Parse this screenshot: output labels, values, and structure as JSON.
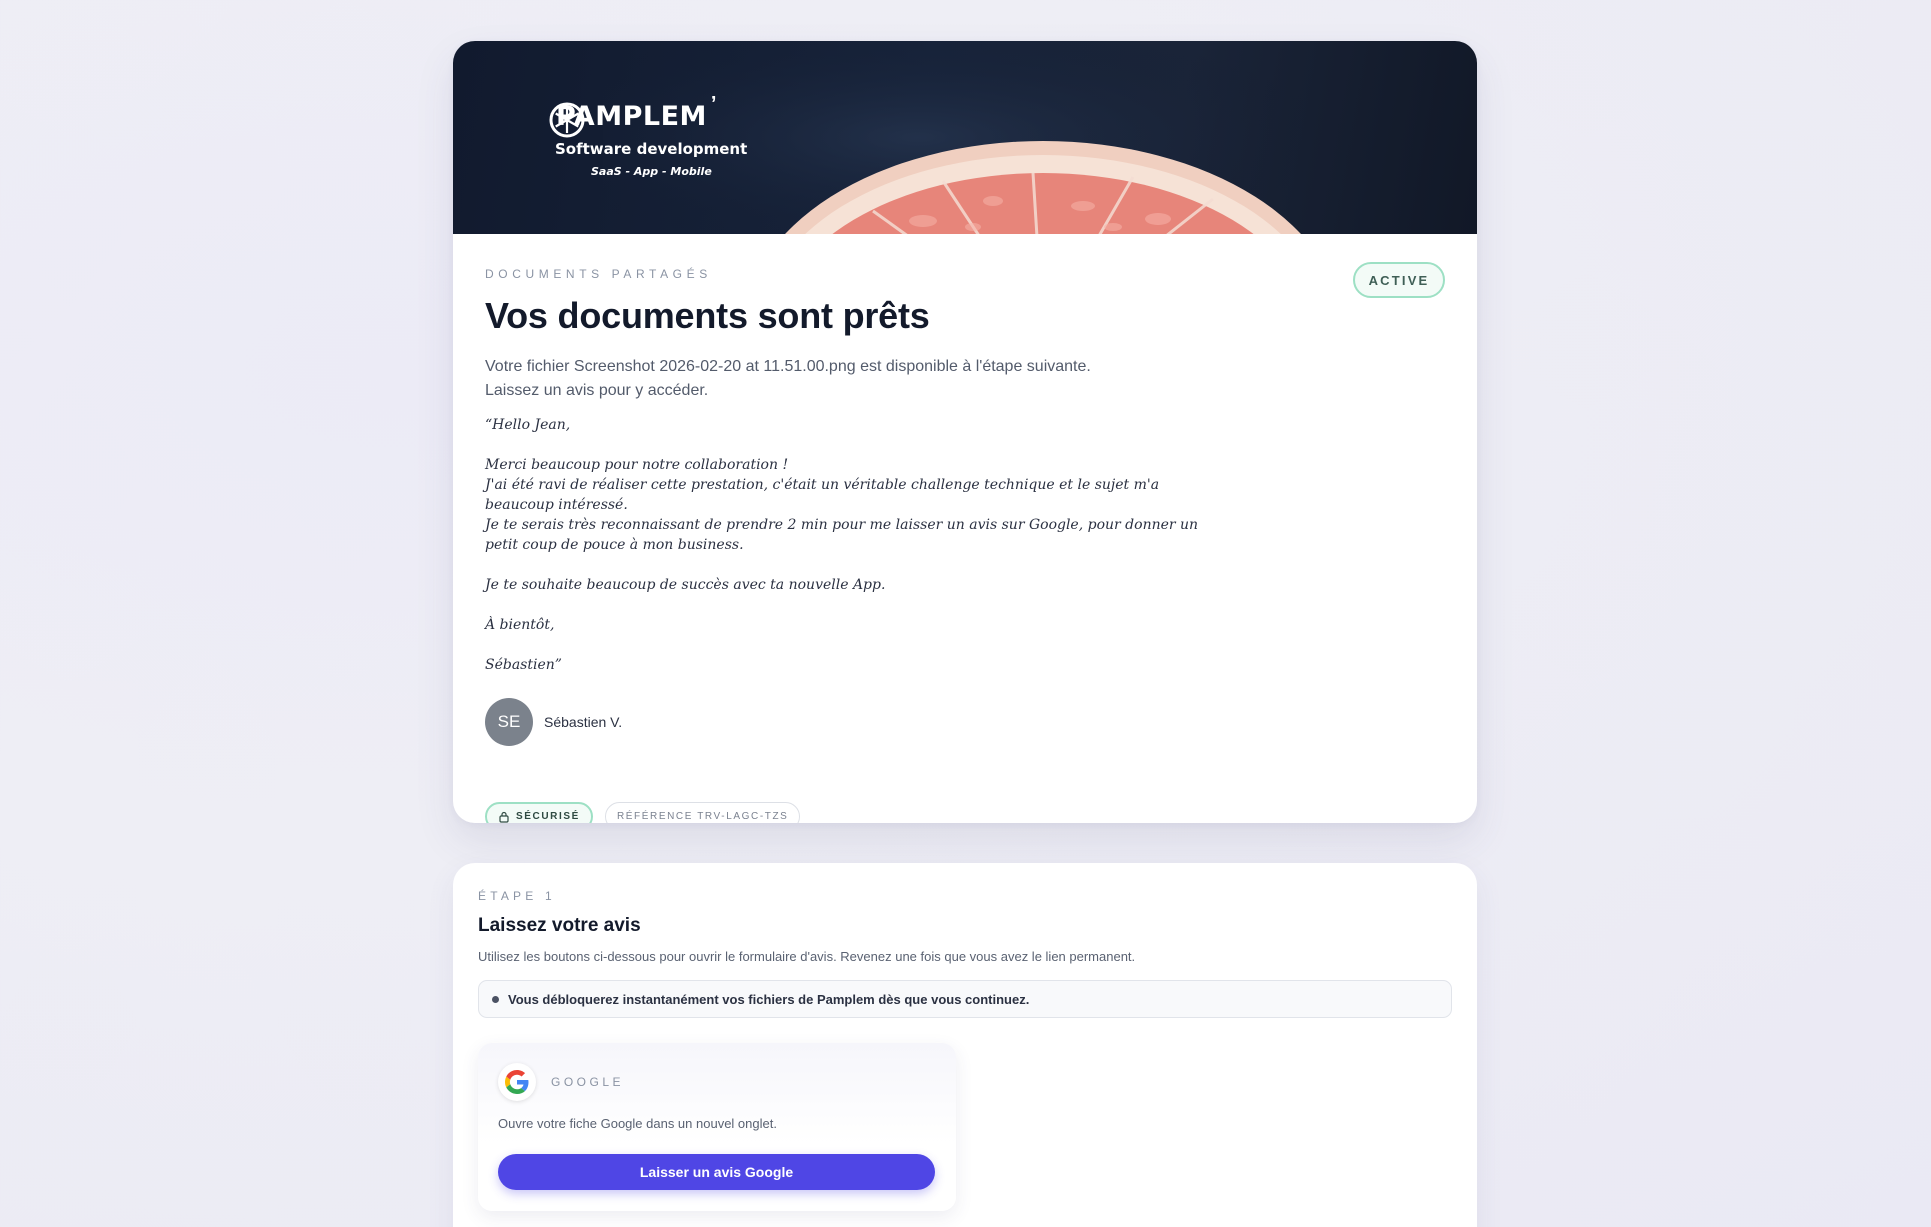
{
  "hero": {
    "brand_name": "PAMPLEM",
    "tagline": "Software development",
    "subtagline": "SaaS - App - Mobile"
  },
  "document": {
    "kicker": "DOCUMENTS PARTAGÉS",
    "status": "ACTIVE",
    "title": "Vos documents sont prêts",
    "description_line1": "Votre fichier Screenshot 2026-02-20 at 11.51.00.png est disponible à l'étape suivante.",
    "description_line2": "Laissez un avis pour y accéder.",
    "letter": [
      "“Hello Jean,",
      "Merci beaucoup pour notre collaboration !\nJ'ai été ravi de réaliser cette prestation, c'était un véritable challenge technique et le sujet m'a beaucoup intéressé.\nJe te serais très reconnaissant de prendre 2 min pour me laisser un avis sur Google, pour donner un petit coup de pouce à mon business.",
      "Je te souhaite beaucoup de succès avec ta nouvelle App.",
      "À bientôt,",
      "Sébastien”"
    ],
    "author_initials": "SE",
    "author_name": "Sébastien V.",
    "chip_secure": "SÉCURISÉ",
    "chip_reference": "RÉFÉRENCE TRV-LAGC-TZS"
  },
  "step": {
    "kicker": "ÉTAPE 1",
    "title": "Laissez votre avis",
    "description": "Utilisez les boutons ci-dessous pour ouvrir le formulaire d'avis. Revenez une fois que vous avez le lien permanent.",
    "info": "Vous débloquerez instantanément vos fichiers de Pamplem dès que vous continuez.",
    "review": {
      "provider": "GOOGLE",
      "provider_icon": "google-g-icon",
      "description": "Ouvre votre fiche Google dans un nouvel onglet.",
      "button_label": "Laisser un avis Google"
    }
  },
  "colors": {
    "accent": "#4f46e5",
    "badge_border": "#9de0c4",
    "hero_bg": "#111a2e",
    "grapefruit": "#e06a62"
  }
}
